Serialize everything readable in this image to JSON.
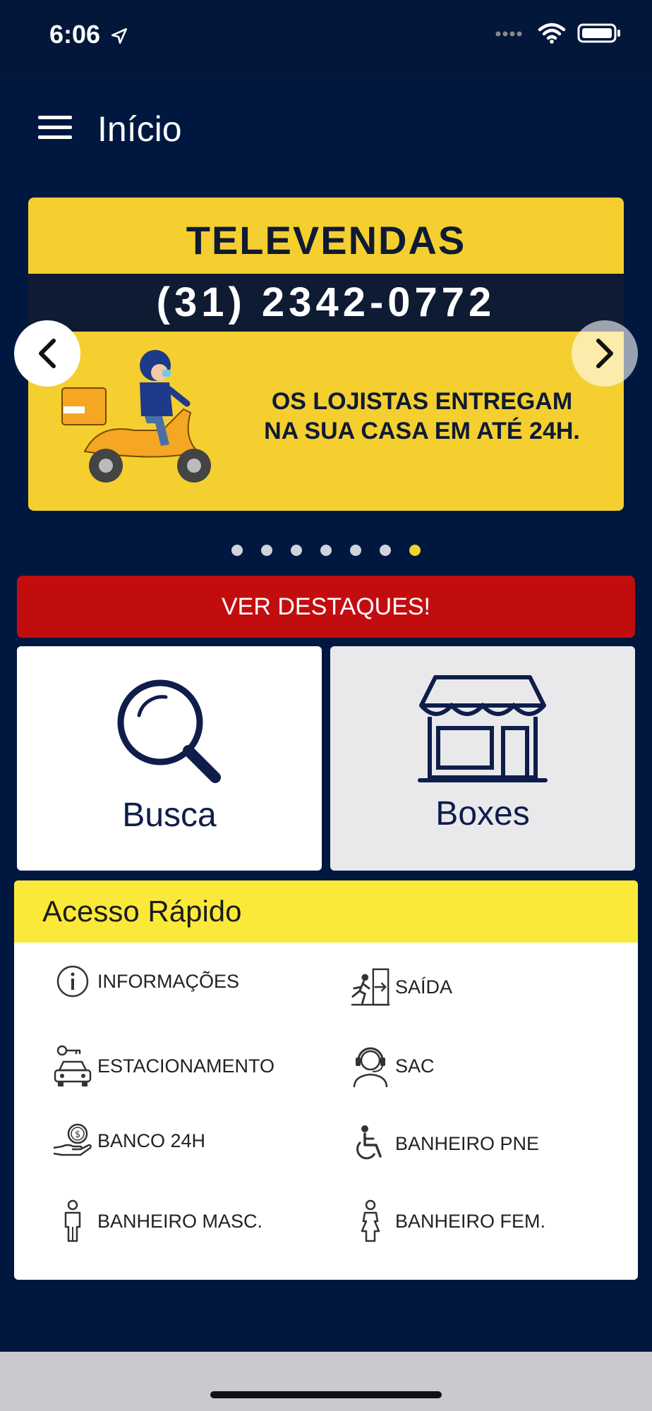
{
  "status_bar": {
    "time": "6:06"
  },
  "header": {
    "title": "Início"
  },
  "banner": {
    "title": "TELEVENDAS",
    "phone": "(31) 2342-0772",
    "subtitle_line1": "OS LOJISTAS ENTREGAM",
    "subtitle_line2": "NA SUA CASA EM ATÉ 24H.",
    "dots_total": 7,
    "active_dot": 7
  },
  "highlights_button": {
    "label": "VER DESTAQUES!"
  },
  "tiles": [
    {
      "label": "Busca",
      "icon": "search-icon"
    },
    {
      "label": "Boxes",
      "icon": "store-icon"
    }
  ],
  "quick_access": {
    "title": "Acesso Rápido",
    "items": [
      {
        "label": "INFORMAÇÕES",
        "icon": "info-icon"
      },
      {
        "label": "SAÍDA",
        "icon": "exit-icon"
      },
      {
        "label": "ESTACIONAMENTO",
        "icon": "parking-car-icon"
      },
      {
        "label": "SAC",
        "icon": "headset-support-icon"
      },
      {
        "label": "BANCO 24H",
        "icon": "coin-hand-icon"
      },
      {
        "label": "BANHEIRO PNE",
        "icon": "wheelchair-icon"
      },
      {
        "label": "BANHEIRO MASC.",
        "icon": "male-icon"
      },
      {
        "label": "BANHEIRO FEM.",
        "icon": "female-icon"
      }
    ]
  },
  "colors": {
    "background": "#001840",
    "accent_red": "#c20d0f",
    "accent_yellow": "#fbe93a",
    "banner_yellow": "#f4cf2f",
    "dark_navy": "#0e1d4a"
  }
}
